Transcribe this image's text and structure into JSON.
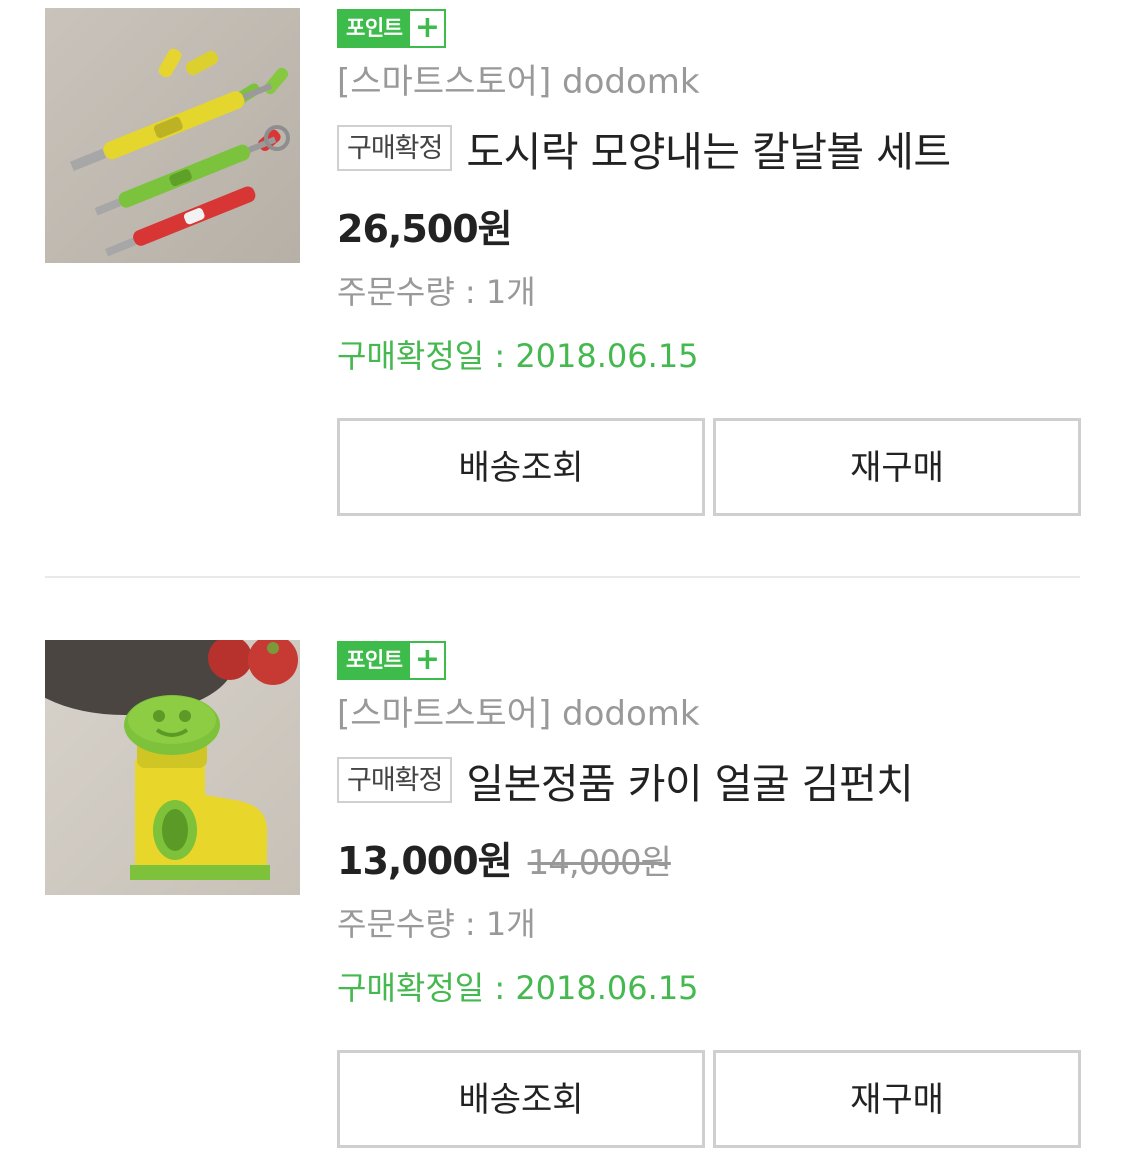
{
  "orders": [
    {
      "point_badge": "포인트",
      "point_plus": "+",
      "store": "[스마트스토어] dodomk",
      "status": "구매확정",
      "product_name": "도시락 모양내는 칼날볼 세트",
      "price": "26,500원",
      "original_price": "",
      "quantity": "주문수량 : 1개",
      "confirm_date": "구매확정일 : 2018.06.15",
      "btn_track": "배송조회",
      "btn_rebuy": "재구매"
    },
    {
      "point_badge": "포인트",
      "point_plus": "+",
      "store": "[스마트스토어] dodomk",
      "status": "구매확정",
      "product_name": "일본정품 카이 얼굴 김펀치",
      "price": "13,000원",
      "original_price": "14,000원",
      "quantity": "주문수량 : 1개",
      "confirm_date": "구매확정일 : 2018.06.15",
      "btn_track": "배송조회",
      "btn_rebuy": "재구매"
    }
  ],
  "colors": {
    "accent_green": "#3dbb4b",
    "confirm_green": "#45b84f",
    "muted_text": "#999999"
  }
}
